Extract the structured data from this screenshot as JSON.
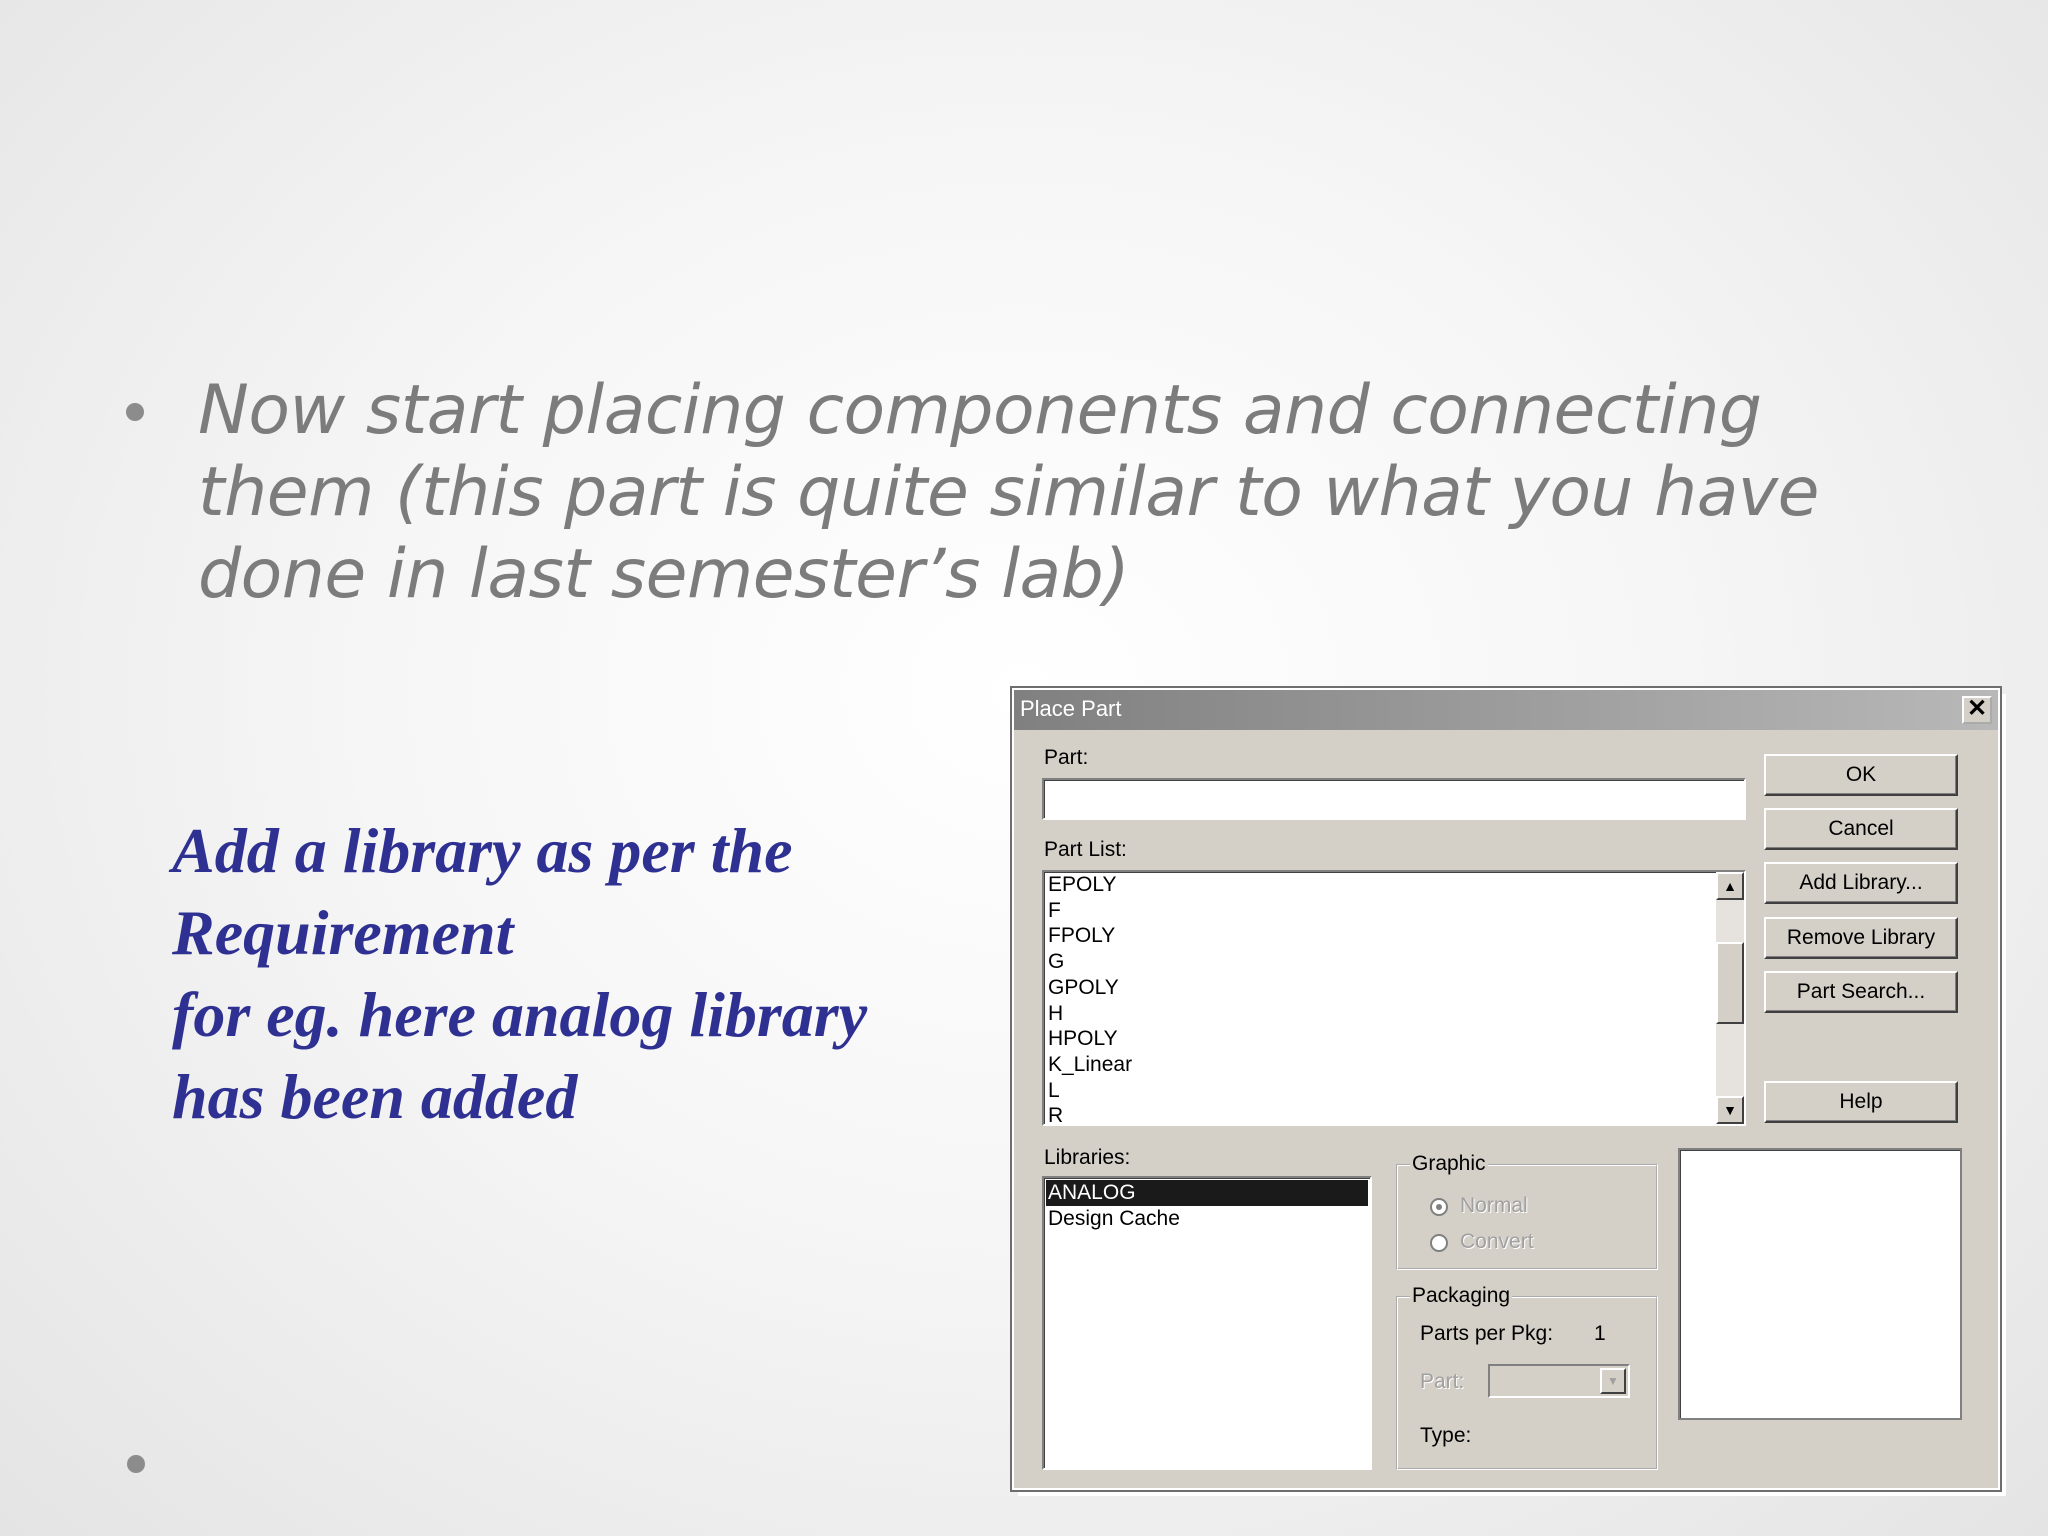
{
  "slide": {
    "bullet_text": "Now start placing components and connecting them (this part is quite similar to what you have done in last semester’s lab)",
    "note_lines": [
      "Add a library as per the",
      "Requirement",
      "for eg. here analog library",
      "has been added"
    ]
  },
  "dialog": {
    "title": "Place Part",
    "close_glyph": "✕",
    "part_label": "Part:",
    "part_value": "",
    "part_list_label": "Part List:",
    "part_list": [
      "EPOLY",
      "F",
      "FPOLY",
      "G",
      "GPOLY",
      "H",
      "HPOLY",
      "K_Linear",
      "L",
      "R"
    ],
    "scroll_up_glyph": "▲",
    "scroll_down_glyph": "▼",
    "buttons": {
      "ok": "OK",
      "cancel": "Cancel",
      "add_library": "Add Library...",
      "remove_library": "Remove Library",
      "part_search": "Part Search...",
      "help": "Help"
    },
    "libraries_label": "Libraries:",
    "libraries": [
      "ANALOG",
      "Design Cache"
    ],
    "selected_library": "ANALOG",
    "graphic": {
      "title": "Graphic",
      "normal": "Normal",
      "convert": "Convert"
    },
    "packaging": {
      "title": "Packaging",
      "parts_per_pkg_label": "Parts per Pkg:",
      "parts_per_pkg_value": "1",
      "part_label": "Part:",
      "type_label": "Type:"
    }
  },
  "colors": {
    "note_text": "#2e3192",
    "bullet_text": "#7c7c7c",
    "dialog_face": "#d4d0c8"
  }
}
